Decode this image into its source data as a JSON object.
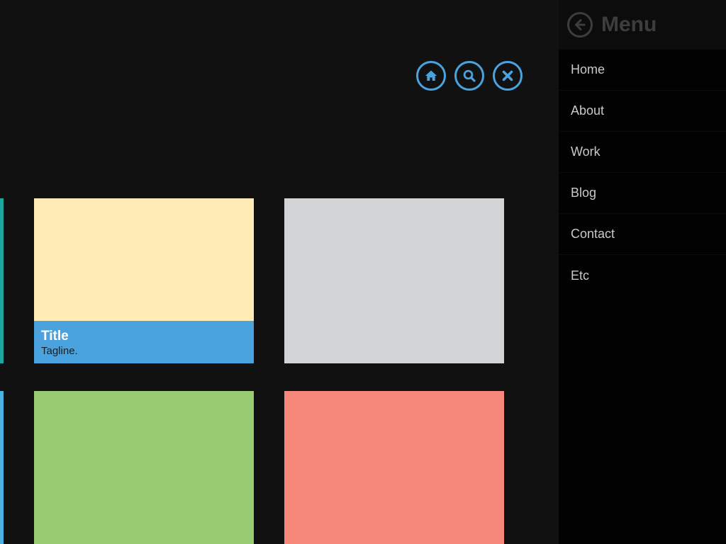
{
  "toolbar": {
    "buttons": [
      {
        "icon": "home-icon"
      },
      {
        "icon": "search-icon"
      },
      {
        "icon": "close-icon"
      }
    ],
    "accent_color": "#4aa3df"
  },
  "tiles": [
    {
      "color": "#ffebb5",
      "caption": {
        "title": "Title",
        "tagline": "Tagline.",
        "color": "#4aa3df"
      }
    },
    {
      "color": "#d3d4d6"
    },
    {
      "color": "#99cc72"
    },
    {
      "color": "#f5877b"
    }
  ],
  "edge_strips": [
    {
      "color": "#1aa89c"
    },
    {
      "color": "#4ab2e2"
    }
  ],
  "menu": {
    "back_icon": "arrow-left-circle-icon",
    "title": "Menu",
    "items": [
      {
        "label": "Home"
      },
      {
        "label": "About"
      },
      {
        "label": "Work"
      },
      {
        "label": "Blog"
      },
      {
        "label": "Contact"
      },
      {
        "label": "Etc"
      }
    ]
  }
}
